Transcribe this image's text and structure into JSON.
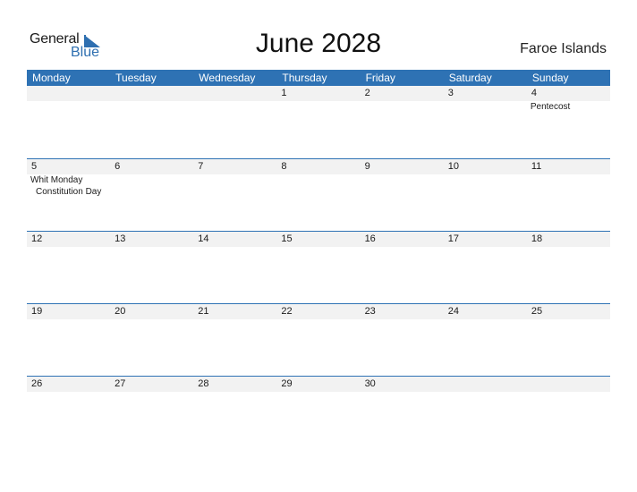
{
  "logo": {
    "text_general": "General",
    "text_blue": "Blue"
  },
  "title": "June 2028",
  "country": "Faroe Islands",
  "colors": {
    "accent": "#2e72b4",
    "strip": "#f2f2f2"
  },
  "weekdays": [
    "Monday",
    "Tuesday",
    "Wednesday",
    "Thursday",
    "Friday",
    "Saturday",
    "Sunday"
  ],
  "weeks": [
    {
      "days": [
        {
          "num": "",
          "events": []
        },
        {
          "num": "",
          "events": []
        },
        {
          "num": "",
          "events": []
        },
        {
          "num": "1",
          "events": []
        },
        {
          "num": "2",
          "events": []
        },
        {
          "num": "3",
          "events": []
        },
        {
          "num": "4",
          "events": [
            "Pentecost"
          ]
        }
      ]
    },
    {
      "days": [
        {
          "num": "5",
          "events": [
            "Whit Monday",
            " Constitution Day"
          ]
        },
        {
          "num": "6",
          "events": []
        },
        {
          "num": "7",
          "events": []
        },
        {
          "num": "8",
          "events": []
        },
        {
          "num": "9",
          "events": []
        },
        {
          "num": "10",
          "events": []
        },
        {
          "num": "11",
          "events": []
        }
      ]
    },
    {
      "days": [
        {
          "num": "12",
          "events": []
        },
        {
          "num": "13",
          "events": []
        },
        {
          "num": "14",
          "events": []
        },
        {
          "num": "15",
          "events": []
        },
        {
          "num": "16",
          "events": []
        },
        {
          "num": "17",
          "events": []
        },
        {
          "num": "18",
          "events": []
        }
      ]
    },
    {
      "days": [
        {
          "num": "19",
          "events": []
        },
        {
          "num": "20",
          "events": []
        },
        {
          "num": "21",
          "events": []
        },
        {
          "num": "22",
          "events": []
        },
        {
          "num": "23",
          "events": []
        },
        {
          "num": "24",
          "events": []
        },
        {
          "num": "25",
          "events": []
        }
      ]
    },
    {
      "days": [
        {
          "num": "26",
          "events": []
        },
        {
          "num": "27",
          "events": []
        },
        {
          "num": "28",
          "events": []
        },
        {
          "num": "29",
          "events": []
        },
        {
          "num": "30",
          "events": []
        },
        {
          "num": "",
          "events": []
        },
        {
          "num": "",
          "events": []
        }
      ]
    }
  ]
}
